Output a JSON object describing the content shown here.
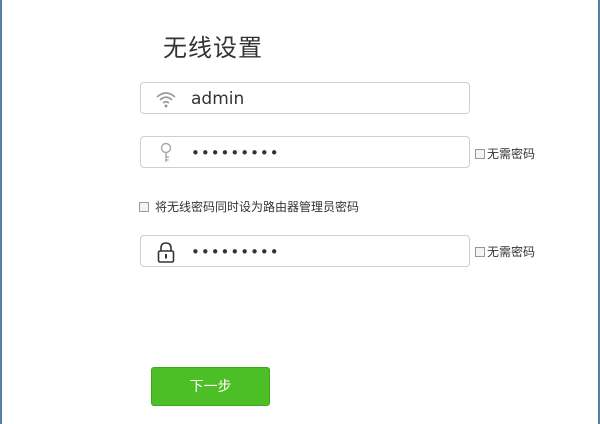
{
  "page_title": "无线设置",
  "ssid": {
    "value": "admin",
    "icon": "wifi-icon"
  },
  "wifi_password": {
    "value": "•••••••••",
    "icon": "key-icon"
  },
  "no_password_label_1": "无需密码",
  "same_as_admin_label": "将无线密码同时设为路由器管理员密码",
  "admin_password": {
    "value": "•••••••••",
    "icon": "lock-icon"
  },
  "no_password_label_2": "无需密码",
  "next_button": "下一步",
  "colors": {
    "accent": "#4cbf27",
    "border": "#cfcfcf"
  }
}
